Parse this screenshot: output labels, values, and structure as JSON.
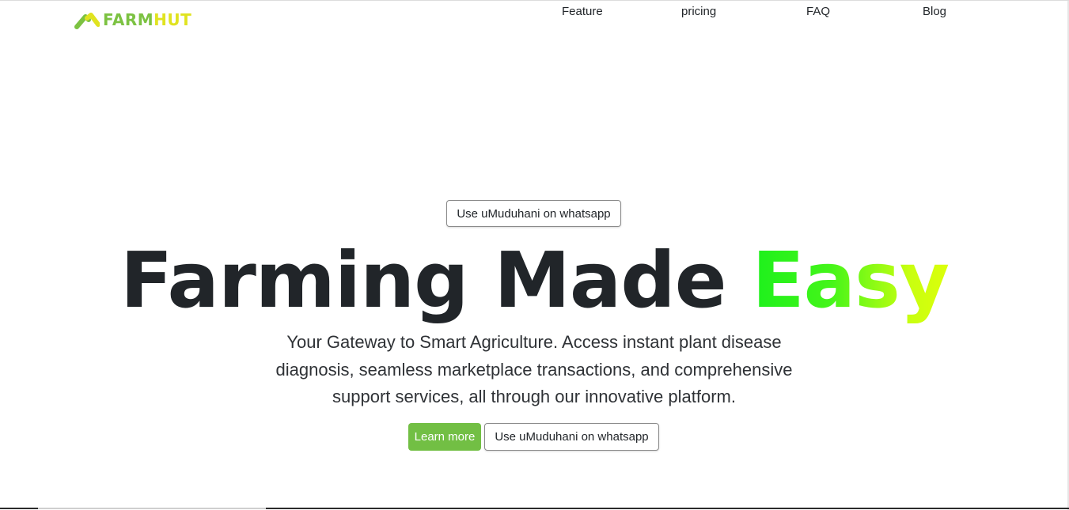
{
  "brand": {
    "part1": "FARM",
    "part2": "HUT",
    "primary_color": "#7cc242",
    "secondary_color": "#e0e320"
  },
  "nav": {
    "items": [
      "Feature",
      "pricing",
      "FAQ",
      "Blog"
    ]
  },
  "hero": {
    "top_button": "Use uMuduhani on whatsapp",
    "headline_main": "Farming Made ",
    "headline_accent": "Easy",
    "subtitle": "Your Gateway to Smart Agriculture. Access instant plant disease diagnosis, seamless marketplace transactions, and comprehensive support services, all through our innovative platform.",
    "learn_more": "Learn more",
    "whatsapp_button": "Use uMuduhani on whatsapp",
    "accent_gradient": [
      "#1cf01c",
      "#dcff0a"
    ],
    "learn_color": "#72bf44"
  }
}
